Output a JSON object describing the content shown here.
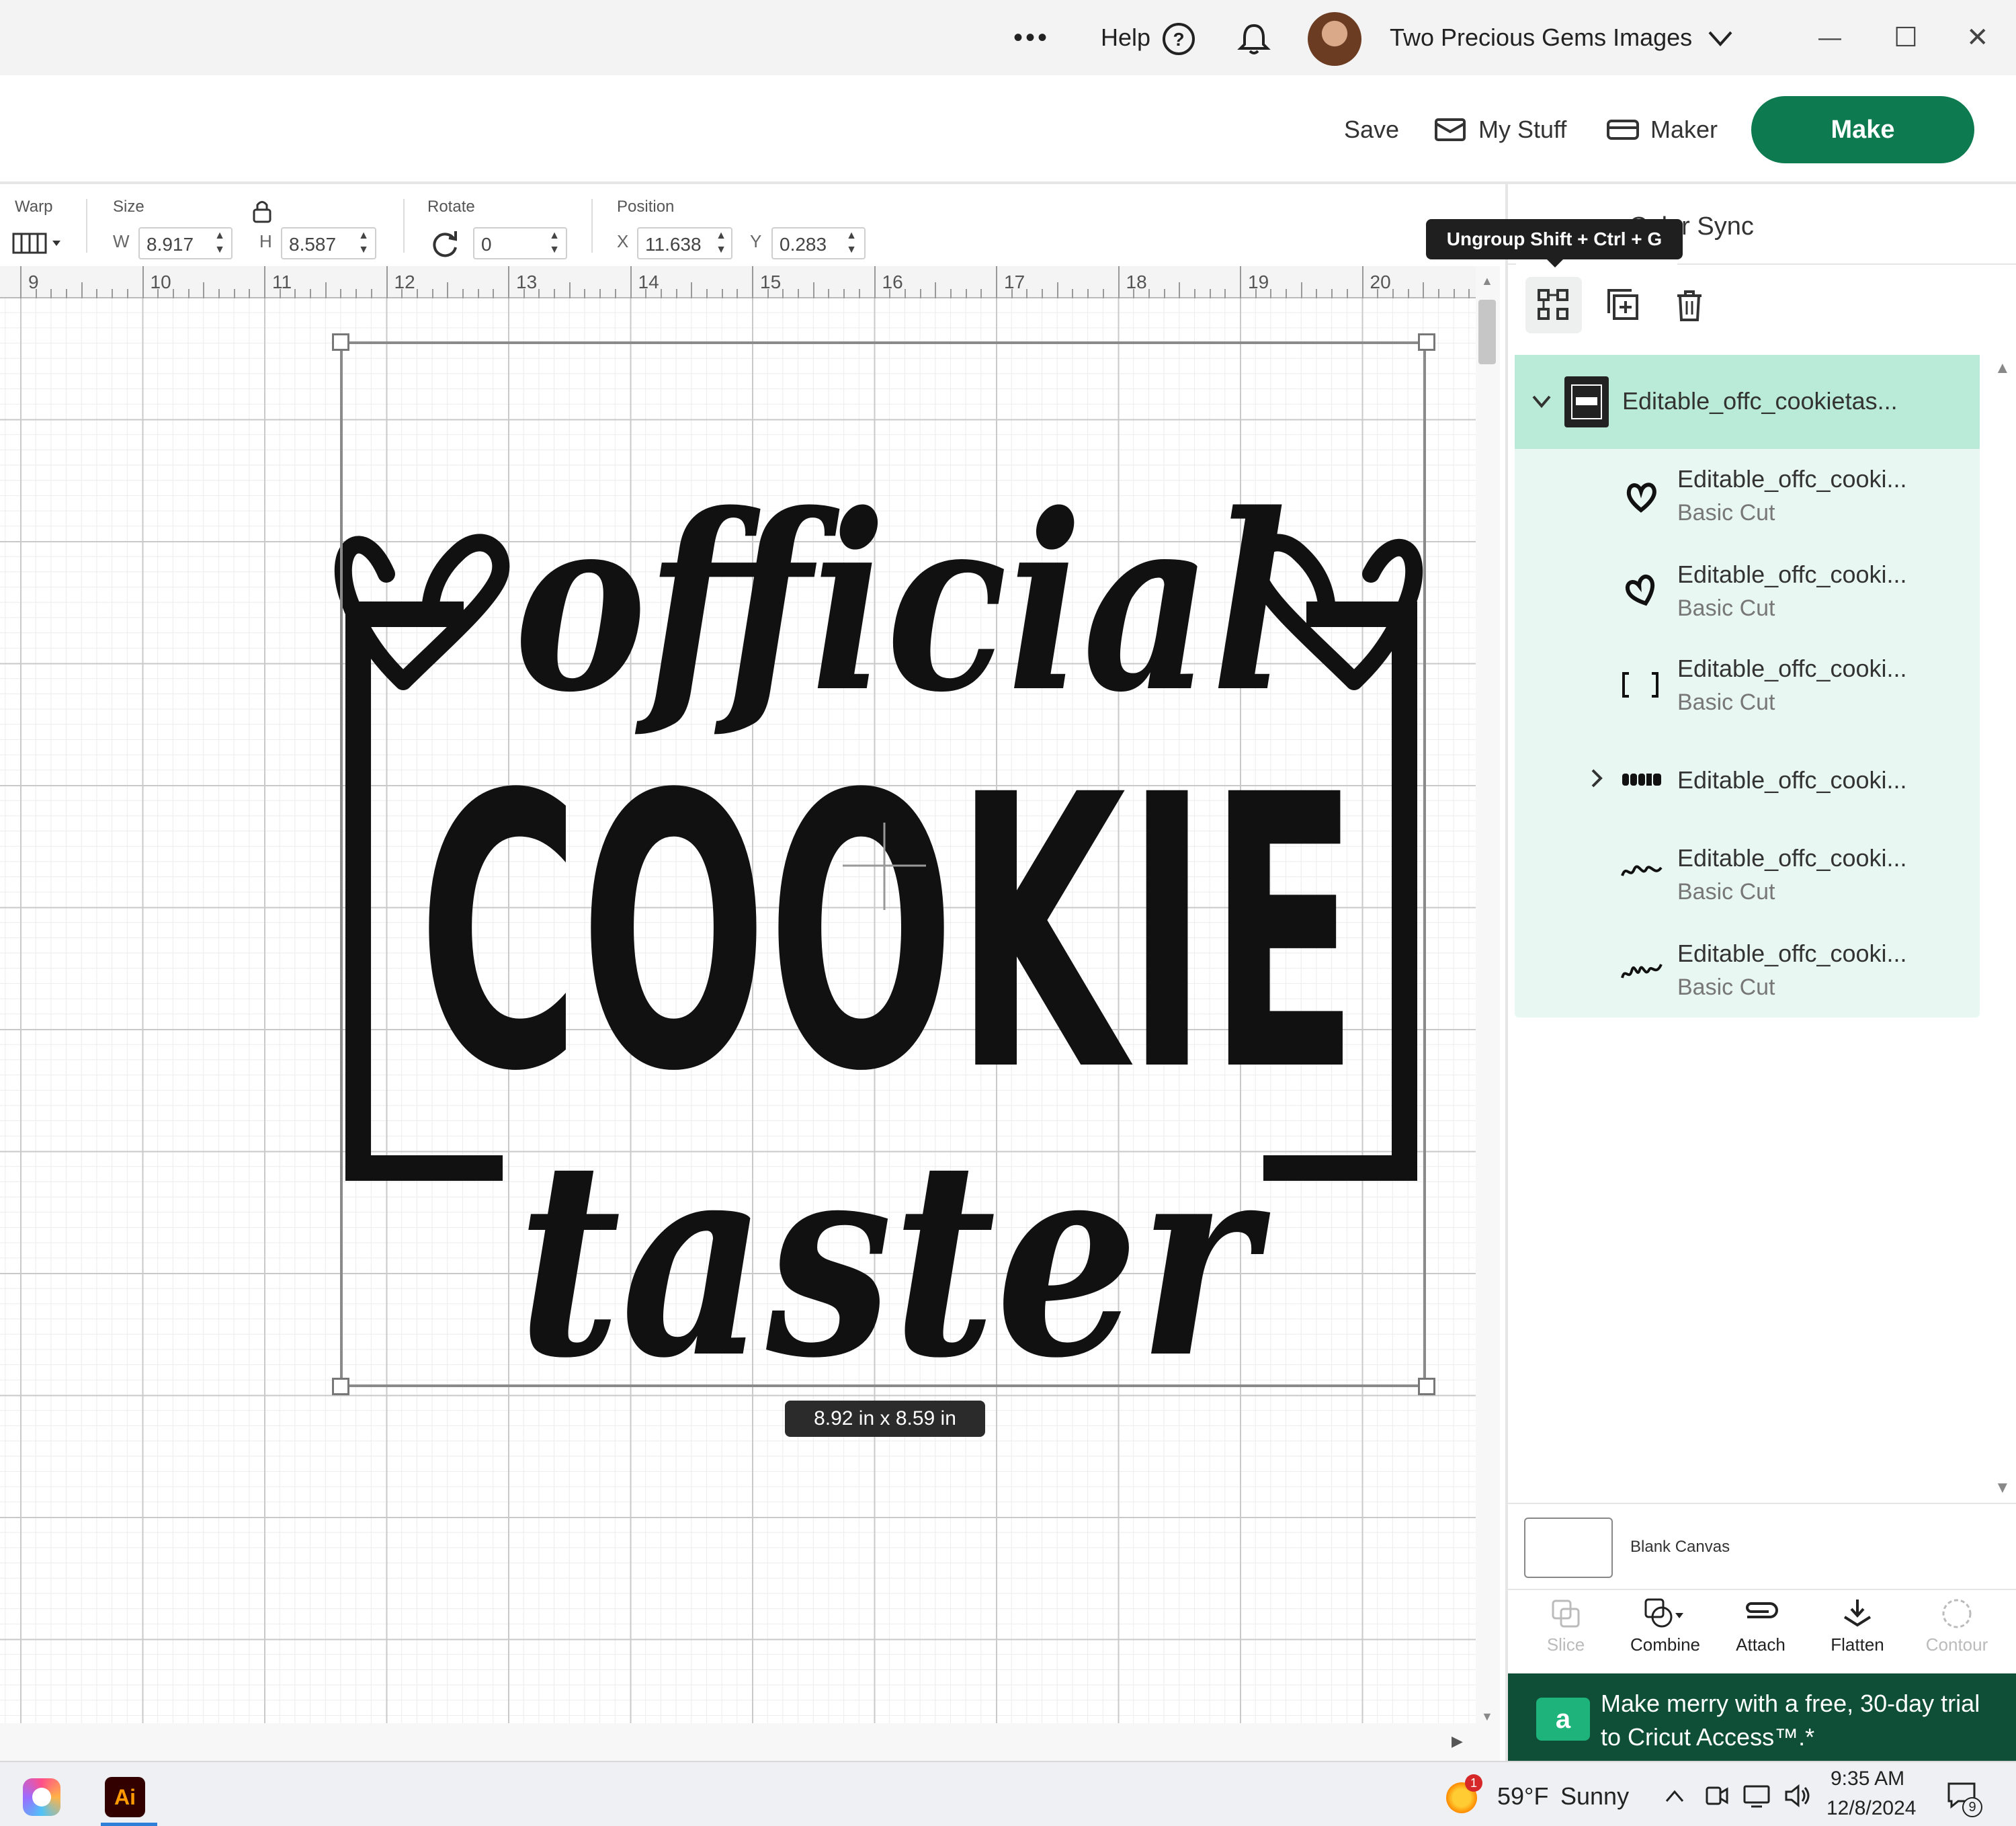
{
  "titlebar": {
    "more_label": "•••",
    "help_label": "Help",
    "account_name": "Two Precious Gems Images",
    "minimize": "—",
    "maximize": "☐",
    "close": "✕"
  },
  "header": {
    "save_label": "Save",
    "my_stuff_label": "My Stuff",
    "maker_label": "Maker",
    "make_label": "Make"
  },
  "toolbar": {
    "warp_label": "Warp",
    "size_label": "Size",
    "w_label": "W",
    "width_value": "8.917",
    "h_label": "H",
    "height_value": "8.587",
    "rotate_label": "Rotate",
    "rotate_value": "0",
    "position_label": "Position",
    "x_label": "X",
    "x_value": "11.638",
    "y_label": "Y",
    "y_value": "0.283"
  },
  "ruler": {
    "numbers": [
      "9",
      "10",
      "11",
      "12",
      "13",
      "14",
      "15",
      "16",
      "17",
      "18",
      "19",
      "20"
    ]
  },
  "canvas": {
    "design_words": {
      "word1": "official",
      "word2": "COOKIE",
      "word3": "taster"
    },
    "dimension_label": "8.92  in x 8.59  in"
  },
  "right_panel": {
    "tab_color_sync": "Color Sync",
    "tooltip": "Ungroup Shift + Ctrl + G",
    "group_name": "Editable_offc_cookietas...",
    "layers": [
      {
        "name": "Editable_offc_cooki...",
        "sub": "Basic Cut",
        "thumb": "heart-icon"
      },
      {
        "name": "Editable_offc_cooki...",
        "sub": "Basic Cut",
        "thumb": "heart-icon"
      },
      {
        "name": "Editable_offc_cooki...",
        "sub": "Basic Cut",
        "thumb": "bracket-icon"
      },
      {
        "name": "Editable_offc_cooki...",
        "sub": "",
        "thumb": "cookie-text-icon"
      },
      {
        "name": "Editable_offc_cooki...",
        "sub": "Basic Cut",
        "thumb": "taster-text-icon"
      },
      {
        "name": "Editable_offc_cooki...",
        "sub": "Basic Cut",
        "thumb": "official-text-icon"
      }
    ],
    "blank_canvas_label": "Blank Canvas",
    "actions": {
      "slice": "Slice",
      "combine": "Combine",
      "attach": "Attach",
      "flatten": "Flatten",
      "contour": "Contour"
    },
    "promo_text": "Make merry with a free, 30-day trial to Cricut Access™.*",
    "promo_icon_letter": "a"
  },
  "taskbar": {
    "notification_count": "1",
    "temperature": "59°F",
    "weather": "Sunny",
    "time": "9:35 AM",
    "date": "12/8/2024",
    "notification_badge": "9",
    "ai_label": "Ai"
  },
  "colors": {
    "make_button": "#0e7a50",
    "layer_selected": "#b9ebd8",
    "layer_group_bg": "#e8f7f1",
    "promo_bg": "#0f4f38"
  }
}
